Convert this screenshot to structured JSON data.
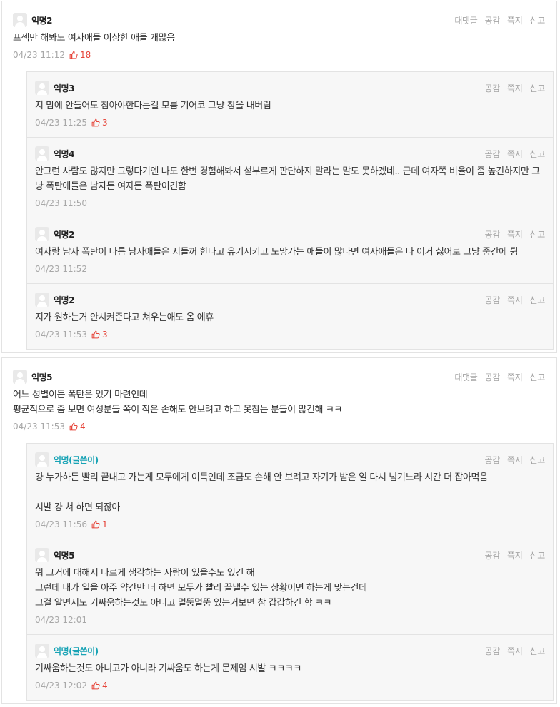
{
  "labels": {
    "reply": "대댓글",
    "like": "공감",
    "message": "쪽지",
    "report": "신고"
  },
  "threads": [
    {
      "author": "익명2",
      "text": "프젝만 해봐도 여자애들 이상한 애들 개많음",
      "time": "04/23 11:12",
      "likes": "18",
      "replies": [
        {
          "author": "익명3",
          "op": false,
          "text": "지 맘에 안들어도 참아야한다는걸 모름 기어코 그냥 창을 내버림",
          "time": "04/23 11:25",
          "likes": "3"
        },
        {
          "author": "익명4",
          "op": false,
          "text": "안그런 사람도 많지만 그렇다기엔 나도 한번 경험해봐서 섣부르게 판단하지 말라는 말도 못하겠네.. 근데 여자쪽 비율이 좀 높긴하지만 그냥 폭탄애들은 남자든 여자든 폭탄이긴함",
          "time": "04/23 11:50",
          "likes": ""
        },
        {
          "author": "익명2",
          "op": false,
          "text": "여자랑 남자 폭탄이 다름 남자애들은 지들꺼 한다고 유기시키고 도망가는 애들이 많다면 여자애들은 다 이거 싫어로 그냥 중간에 튐",
          "time": "04/23 11:52",
          "likes": ""
        },
        {
          "author": "익명2",
          "op": false,
          "text": "지가 원하는거 안시켜준다고 쳐우는애도 옴 에휴",
          "time": "04/23 11:53",
          "likes": "3"
        }
      ]
    },
    {
      "author": "익명5",
      "text": "어느 성별이든 폭탄은 있기 마련인데\n평균적으로 좀 보면 여성분들 쪽이 작은 손해도 안보려고 하고 못참는 분들이 많긴해 ㅋㅋ",
      "time": "04/23 11:53",
      "likes": "4",
      "replies": [
        {
          "author": "익명(글쓴이)",
          "op": true,
          "text": "걍 누가하든 빨리 끝내고 가는게 모두에게 이득인데 조금도 손해 안 보려고 자기가 받은 일 다시 넘기느라 시간 더 잡아먹음\n\n시발 걍 쳐 하면 되잖아",
          "time": "04/23 11:56",
          "likes": "1"
        },
        {
          "author": "익명5",
          "op": false,
          "text": "뭐 그거에 대해서 다르게 생각하는 사람이 있을수도 있긴 해\n그런데 내가 일을 아주 약간만 더 하면 모두가 빨리 끝낼수 있는 상황이면 하는게 맞는건데\n그걸 알면서도 기싸움하는것도 아니고 멀뚱멀뚱 있는거보면 참 갑갑하긴 함 ㅋㅋ",
          "time": "04/23 12:01",
          "likes": ""
        },
        {
          "author": "익명(글쓴이)",
          "op": true,
          "text": "기싸움하는것도 아니고가 아니라 기싸움도 하는게 문제임 시발 ㅋㅋㅋㅋ",
          "time": "04/23 12:02",
          "likes": "4"
        }
      ]
    }
  ]
}
